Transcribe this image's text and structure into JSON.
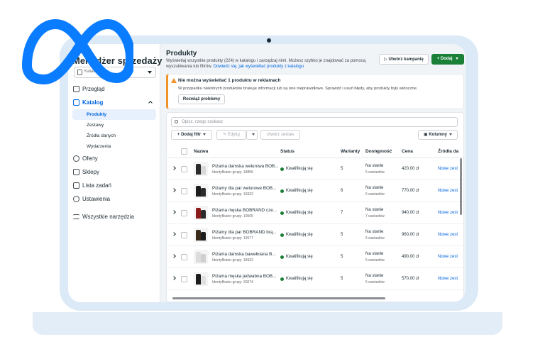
{
  "sidebar": {
    "subtitle": "Meta",
    "title": "Menedżer sprzedaży",
    "catalog_select": "Katalog",
    "items": [
      {
        "label": "Przegląd"
      },
      {
        "label": "Katalog"
      },
      {
        "label": "Oferty"
      },
      {
        "label": "Sklepy"
      },
      {
        "label": "Lista zadań"
      },
      {
        "label": "Ustawienia"
      },
      {
        "label": "Wszystkie narzędzia"
      }
    ],
    "catalog_sub": [
      "Produkty",
      "Zestawy",
      "Źródła danych",
      "Wydarzenia"
    ]
  },
  "header": {
    "title": "Produkty",
    "description": "Wyświetlaj wszystkie produkty (224) w katalogu i zarządzaj nimi. Możesz szybko je znajdować za pomocą wyszukiwania lub filtrów.",
    "link": "Dowiedz się, jak wyświetlać produkty z katalogu",
    "campaign_button": "Utwórz kampanię",
    "add_button": "Dodaj"
  },
  "warning": {
    "title": "Nie można wyświetlać 1 produktu w reklamach",
    "text": "W przypadku niektórych produktów brakuje informacji lub są one nieprawidłowe. Sprawdź i usuń błędy, aby produkty były widoczne.",
    "button": "Rozwiąż problemy"
  },
  "toolbar": {
    "search_placeholder": "Opisz, czego szukasz",
    "filter": "Dodaj filtr",
    "edit": "Edytuj",
    "create_set": "Utwórz zestaw",
    "columns": "Kolumny"
  },
  "table": {
    "columns": [
      "Nazwa",
      "Status",
      "Warianty",
      "Dostępność",
      "Cena",
      "Źródła da"
    ],
    "rows": [
      {
        "name": "Piżama damska welurowa BOB...",
        "id": "Identyfikator grupy: 18856",
        "status": "Kwalifikują się",
        "variants": "5",
        "availability": "Na stanie",
        "avail_sub": "5 wariantów",
        "price": "420,00 zł",
        "source": "Nowe zest",
        "color1": "#2b2b2b",
        "color2": "#d8d8d8"
      },
      {
        "name": "Piżamy dla par welurowe BOB...",
        "id": "Identyfikator grupy: 19332",
        "status": "Kwalifikują się",
        "variants": "6",
        "availability": "Na stanie",
        "avail_sub": "6 wariantów",
        "price": "770,00 zł",
        "source": "Nowe zest",
        "color1": "#1c1c1c",
        "color2": "#2b2b2b"
      },
      {
        "name": "Piżama męska BOBRAND cze...",
        "id": "Identyfikator grupy: 19505",
        "status": "Kwalifikują się",
        "variants": "7",
        "availability": "Na stanie",
        "avail_sub": "7 wariantów",
        "price": "940,00 zł",
        "source": "Nowe zest",
        "color1": "#8b1a1a",
        "color2": "#2b2b2b"
      },
      {
        "name": "Piżamy dla par BOBRAND brą...",
        "id": "Identyfikator grupy: 19577",
        "status": "Kwalifikują się",
        "variants": "5",
        "availability": "Na stanie",
        "avail_sub": "5 wariantów",
        "price": "960,00 zł",
        "source": "Nowe zest",
        "color1": "#3a2a1c",
        "color2": "#1c1c1c"
      },
      {
        "name": "Piżama damska bawełniana B...",
        "id": "Identyfikator grupy: 18932",
        "status": "Kwalifikują się",
        "variants": "5",
        "availability": "Na stanie",
        "avail_sub": "5 wariantów",
        "price": "490,00 zł",
        "source": "Nowe zest",
        "color1": "#dcdcdc",
        "color2": "#cfcfcf"
      },
      {
        "name": "Piżama męska jedwabna BOB...",
        "id": "Identyfikator grupy: 30074",
        "status": "Kwalifikują się",
        "variants": "5",
        "availability": "Na stanie",
        "avail_sub": "5 wariantów",
        "price": "570,00 zł",
        "source": "Nowe zest",
        "color1": "#1c1c1c",
        "color2": "#e0e0e0"
      }
    ]
  },
  "colors": {
    "accent": "#0064e0",
    "add_button": "#1a7f37",
    "warning": "#f0932b",
    "meta_logo": "#0a7cff"
  }
}
